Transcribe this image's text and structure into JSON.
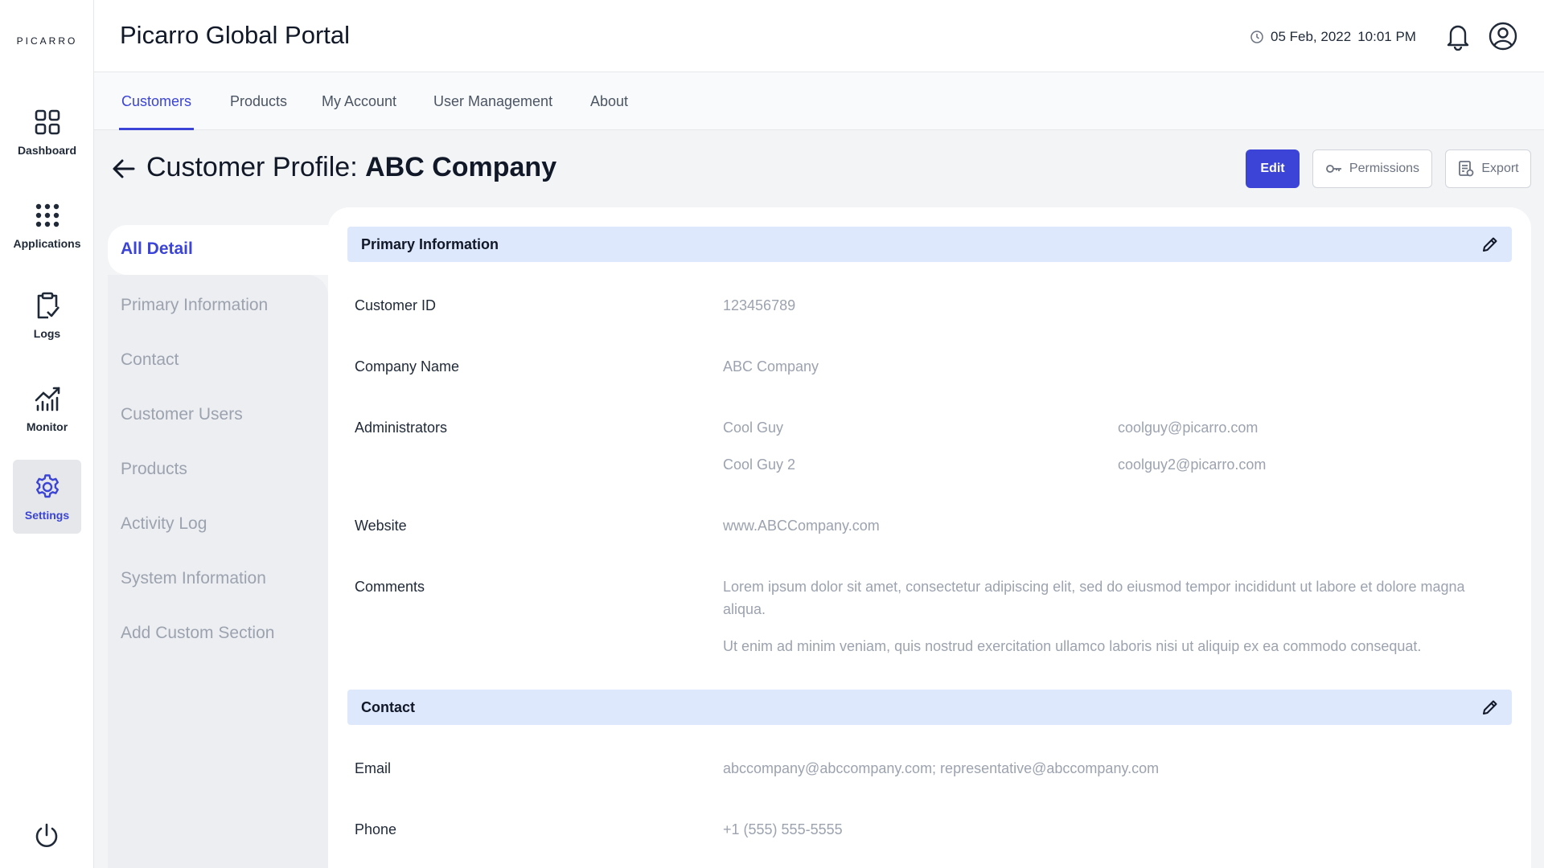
{
  "brand": {
    "logo": "PICARRO"
  },
  "rail": {
    "items": [
      {
        "label": "Dashboard",
        "icon": "grid-icon"
      },
      {
        "label": "Applications",
        "icon": "apps-dots-icon"
      },
      {
        "label": "Logs",
        "icon": "clipboard-check-icon"
      },
      {
        "label": "Monitor",
        "icon": "chart-icon"
      },
      {
        "label": "Settings",
        "icon": "gear-icon",
        "active": true
      }
    ],
    "power_icon": "power-icon"
  },
  "header": {
    "title": "Picarro Global Portal",
    "date": "05 Feb, 2022",
    "time": "10:01 PM"
  },
  "nav": {
    "tabs": [
      {
        "label": "Customers",
        "active": true
      },
      {
        "label": "Products"
      },
      {
        "label": "My Account"
      },
      {
        "label": "User Management"
      },
      {
        "label": "About"
      }
    ]
  },
  "page": {
    "title_prefix": "Customer Profile: ",
    "title_name": "ABC Company",
    "buttons": {
      "edit": "Edit",
      "permissions": "Permissions",
      "export": "Export"
    }
  },
  "sections_nav": {
    "active": "All Detail",
    "items": [
      "Primary Information",
      "Contact",
      "Customer Users",
      "Products",
      "Activity Log",
      "System Information",
      "Add Custom Section"
    ]
  },
  "primary": {
    "heading": "Primary Information",
    "customer_id_label": "Customer ID",
    "customer_id": "123456789",
    "company_name_label": "Company Name",
    "company_name": "ABC Company",
    "administrators_label": "Administrators",
    "administrators": [
      {
        "name": "Cool Guy",
        "email": "coolguy@picarro.com"
      },
      {
        "name": "Cool Guy 2",
        "email": "coolguy2@picarro.com"
      }
    ],
    "website_label": "Website",
    "website": "www.ABCCompany.com",
    "comments_label": "Comments",
    "comments": [
      "Lorem ipsum dolor sit amet, consectetur adipiscing elit, sed do eiusmod tempor incididunt ut labore et dolore magna aliqua.",
      "Ut enim ad minim veniam, quis nostrud exercitation ullamco laboris nisi ut aliquip ex ea commodo consequat."
    ]
  },
  "contact": {
    "heading": "Contact",
    "email_label": "Email",
    "email": "abccompany@abccompany.com; representative@abccompany.com",
    "phone_label": "Phone",
    "phone": "+1 (555) 555-5555"
  },
  "colors": {
    "accent": "#3b44d6",
    "section_header_bg": "#dde8fd",
    "muted_text": "#9ca3af"
  }
}
